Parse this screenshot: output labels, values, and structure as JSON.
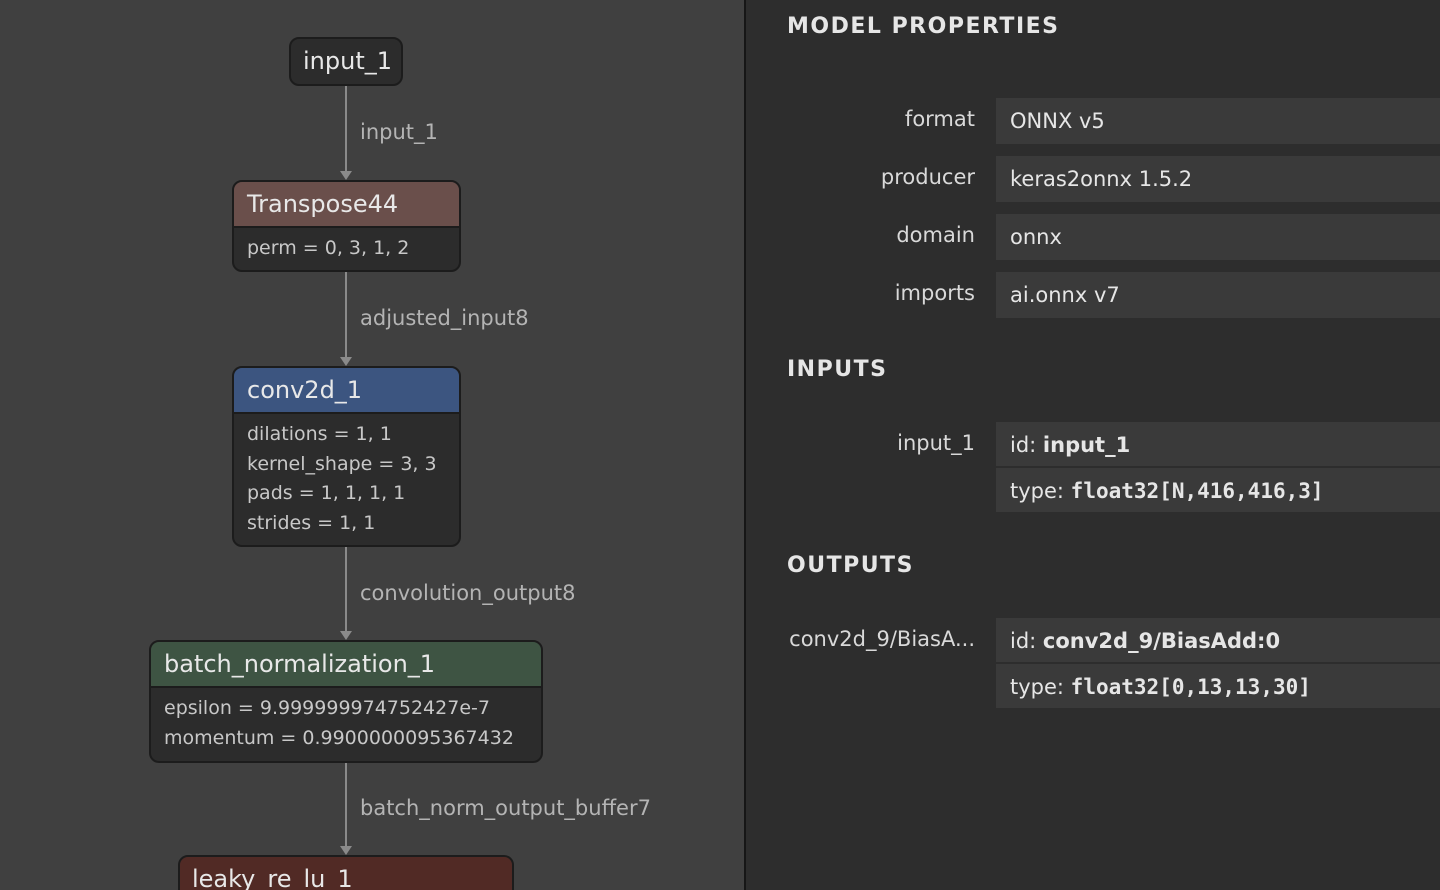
{
  "graph": {
    "nodes": {
      "input_1": {
        "title": "input_1"
      },
      "transpose44": {
        "title": "Transpose44",
        "attrs": [
          "perm = 0, 3, 1, 2"
        ]
      },
      "conv2d_1": {
        "title": "conv2d_1",
        "attrs": [
          "dilations = 1, 1",
          "kernel_shape = 3, 3",
          "pads = 1, 1, 1, 1",
          "strides = 1, 1"
        ]
      },
      "batch_normalization_1": {
        "title": "batch_normalization_1",
        "attrs": [
          "epsilon = 9.999999974752427e-7",
          "momentum = 0.9900000095367432"
        ]
      },
      "leaky_re_lu_1": {
        "title": "leaky_re_lu_1"
      }
    },
    "edges": [
      "input_1",
      "adjusted_input8",
      "convolution_output8",
      "batch_norm_output_buffer7"
    ],
    "colors": {
      "transpose": "#6a4f4b",
      "conv": "#3c5580",
      "batchnorm": "#3e5443",
      "activation": "#512a25"
    }
  },
  "panel": {
    "model_title": "MODEL PROPERTIES",
    "properties": [
      {
        "label": "format",
        "value": "ONNX v5"
      },
      {
        "label": "producer",
        "value": "keras2onnx 1.5.2"
      },
      {
        "label": "domain",
        "value": "onnx"
      },
      {
        "label": "imports",
        "value": "ai.onnx v7"
      }
    ],
    "inputs_title": "INPUTS",
    "inputs": [
      {
        "name": "input_1",
        "id_key": "id: ",
        "id": "input_1",
        "type_key": "type: ",
        "type": "float32[N,416,416,3]"
      }
    ],
    "outputs_title": "OUTPUTS",
    "outputs": [
      {
        "name": "conv2d_9/BiasA...",
        "id_key": "id: ",
        "id": "conv2d_9/BiasAdd:0",
        "type_key": "type: ",
        "type": "float32[0,13,13,30]"
      }
    ]
  }
}
